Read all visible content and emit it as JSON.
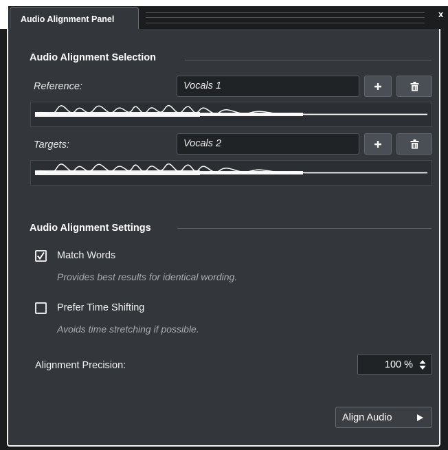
{
  "tab": {
    "title": "Audio Alignment Panel",
    "close": "x"
  },
  "selection": {
    "title": "Audio Alignment Selection",
    "reference": {
      "label": "Reference:",
      "value": "Vocals 1"
    },
    "targets": {
      "label": "Targets:",
      "value": "Vocals 2"
    },
    "add_icon": "plus-icon",
    "delete_icon": "trash-icon"
  },
  "settings": {
    "title": "Audio Alignment Settings",
    "match_words": {
      "label": "Match Words",
      "checked": true,
      "hint": "Provides best results for identical wording."
    },
    "prefer_time_shifting": {
      "label": "Prefer Time Shifting",
      "checked": false,
      "hint": "Avoids time stretching if possible."
    },
    "precision": {
      "label": "Alignment Precision:",
      "value": "100 %"
    }
  },
  "actions": {
    "align_audio": "Align Audio"
  }
}
